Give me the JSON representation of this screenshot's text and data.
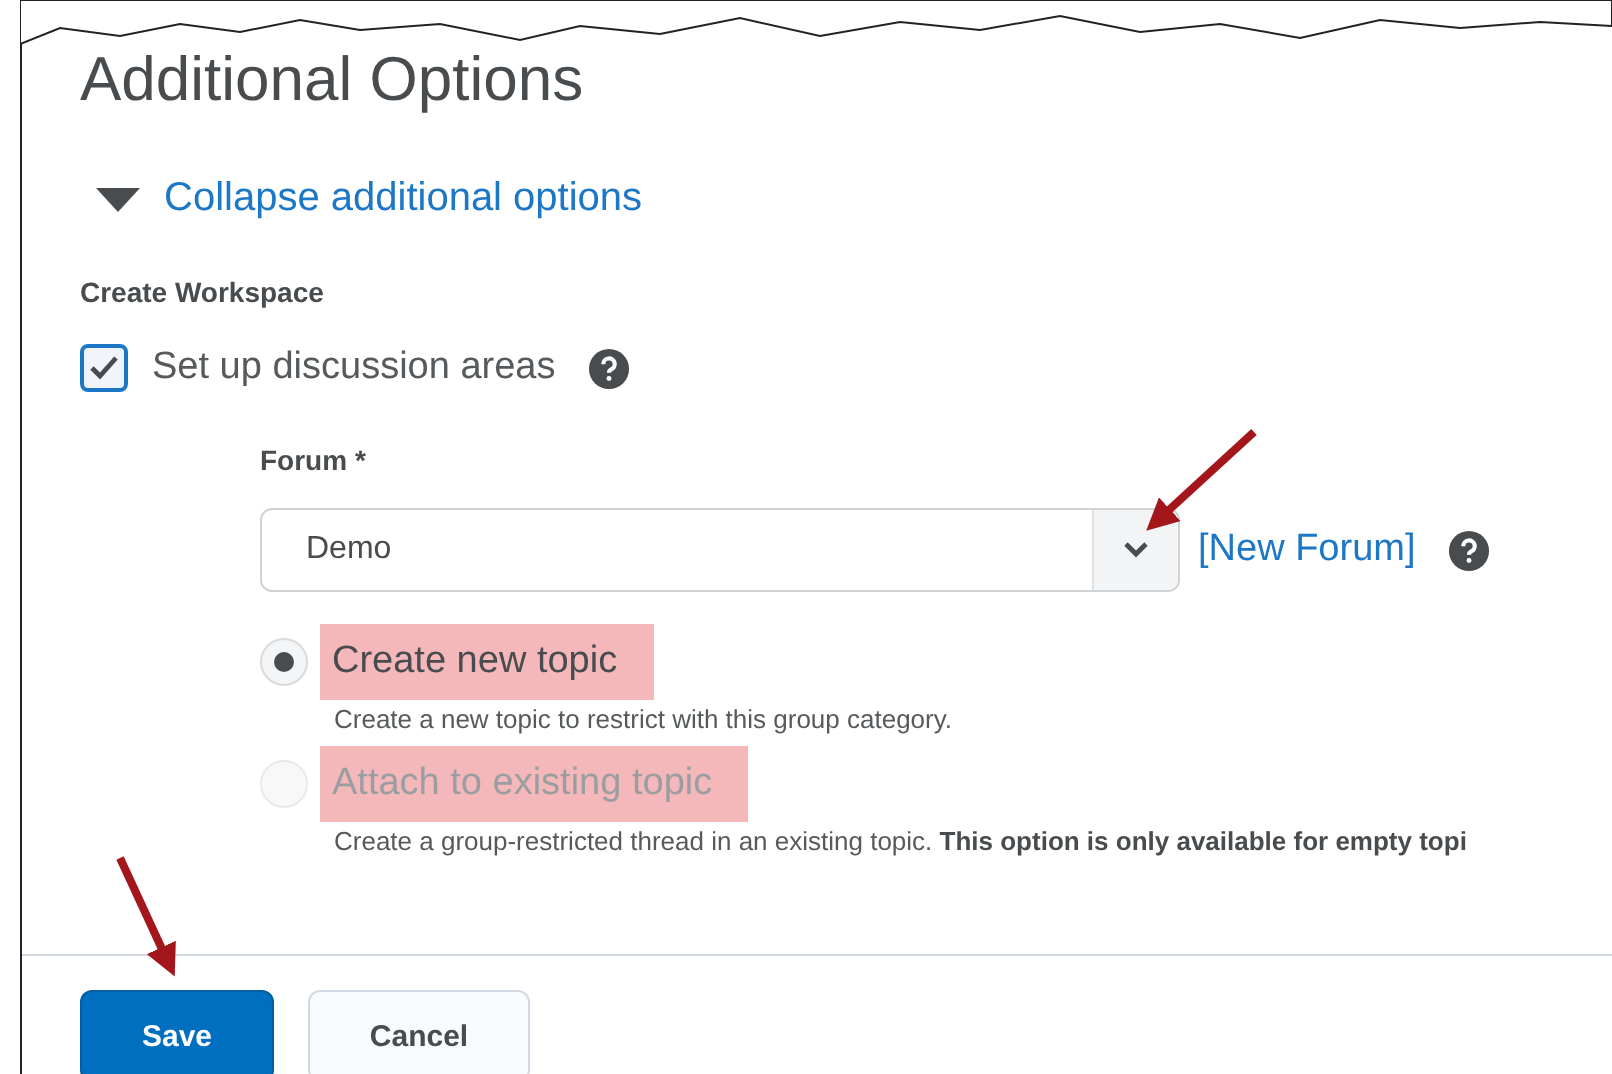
{
  "heading": "Additional Options",
  "collapse_link": {
    "label": "Collapse additional options",
    "expanded": true
  },
  "section_label": "Create Workspace",
  "setup_checkbox": {
    "label": "Set up discussion areas",
    "checked": true
  },
  "forum": {
    "label": "Forum *",
    "value": "Demo",
    "new_link": "[New Forum]"
  },
  "topic_options": [
    {
      "label": "Create new topic",
      "selected": true,
      "disabled": false,
      "highlighted": true,
      "description": "Create a new topic to restrict with this group category."
    },
    {
      "label": "Attach to existing topic",
      "selected": false,
      "disabled": true,
      "highlighted": true,
      "description": "Create a group-restricted thread in an existing topic. **This option is only available for empty topi**"
    }
  ],
  "buttons": [
    {
      "label": "Save",
      "kind": "primary"
    },
    {
      "label": "Cancel",
      "kind": "secondary"
    }
  ]
}
